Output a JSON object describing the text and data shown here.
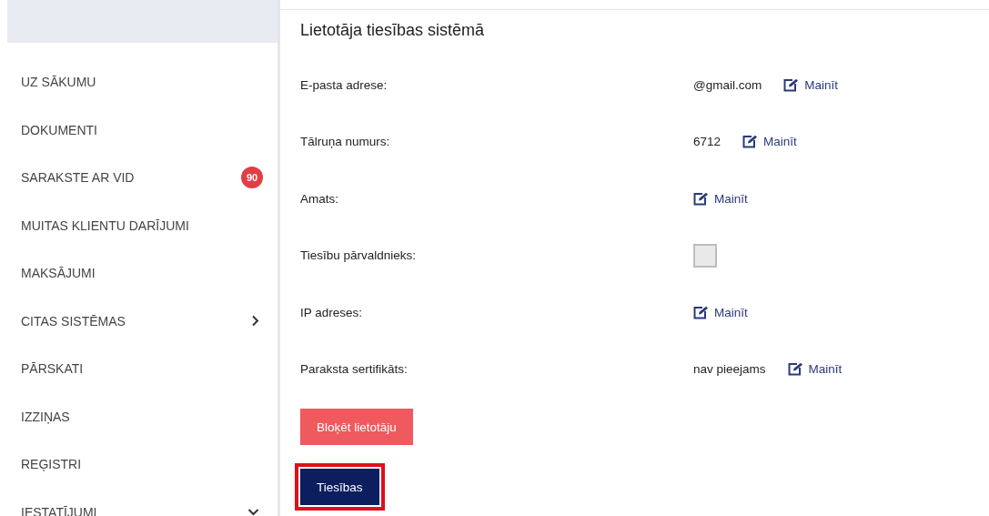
{
  "sidebar": {
    "items": [
      {
        "label": "UZ SĀKUMU",
        "selected": false
      },
      {
        "label": "DOKUMENTI",
        "selected": false
      },
      {
        "label": "SARAKSTE AR VID",
        "selected": false,
        "badge": "90"
      },
      {
        "label": "MUITAS KLIENTU DARĪJUMI",
        "selected": false
      },
      {
        "label": "MAKSĀJUMI",
        "selected": false
      },
      {
        "label": "CITAS SISTĒMAS",
        "selected": false,
        "kind": "submenu"
      },
      {
        "label": "PĀRSKATI",
        "selected": false
      },
      {
        "label": "IZZIŅAS",
        "selected": false
      },
      {
        "label": "REĢISTRI",
        "selected": false
      },
      {
        "label": "IESTATĪJUMI",
        "selected": false,
        "kind": "expandable"
      }
    ]
  },
  "main": {
    "title": "Lietotāja tiesības sistēmā",
    "fields": [
      {
        "kind": "text",
        "label": "E-pasta adrese:",
        "value": "@gmail.com",
        "link": "Mainīt"
      },
      {
        "kind": "text",
        "label": "Tālruņa numurs:",
        "value": "6712",
        "link": "Mainīt"
      },
      {
        "kind": "link",
        "label": "Amats:",
        "link": "Mainīt"
      },
      {
        "kind": "checkbox",
        "label": "Tiesību pārvaldnieks:",
        "checked": false
      },
      {
        "kind": "link",
        "label": "IP adreses:",
        "link": "Mainīt"
      },
      {
        "kind": "text",
        "label": "Paraksta sertifikāts:",
        "value": "nav pieejams",
        "link": "Mainīt"
      }
    ],
    "buttons": [
      {
        "kind": "danger",
        "label": "Bloķēt lietotāju",
        "highlighted": false
      },
      {
        "kind": "primary",
        "label": "Tiesības",
        "highlighted": true
      }
    ]
  }
}
